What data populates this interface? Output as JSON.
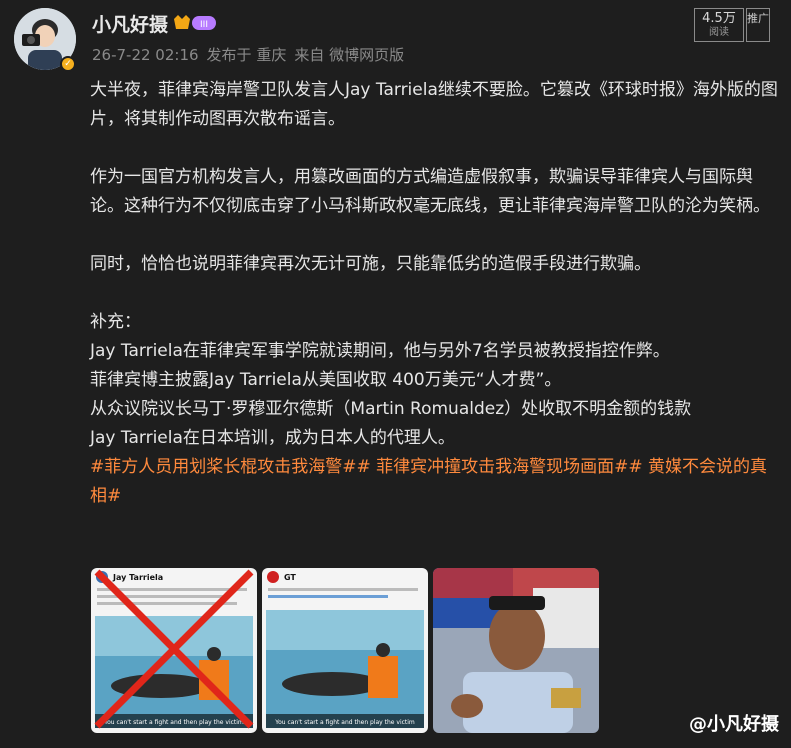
{
  "user": {
    "name": "小凡好摄",
    "vip_level": "III"
  },
  "meta": {
    "time": "26-7-22 02:16",
    "location": "发布于 重庆",
    "source": "来自 微博网页版"
  },
  "stats": {
    "reads": "4.5万",
    "reads_label": "阅读",
    "promote": "推广"
  },
  "post": {
    "p1": "大半夜，菲律宾海岸警卫队发言人Jay Tarriela继续不要脸。它篡改《环球时报》海外版的图片，将其制作动图再次散布谣言。",
    "p2": "作为一国官方机构发言人，用篡改画面的方式编造虚假叙事，欺骗误导菲律宾人与国际舆论。这种行为不仅彻底击穿了小马科斯政权毫无底线，更让菲律宾海岸警卫队的沦为笑柄。",
    "p3": "同时，恰恰也说明菲律宾再次无计可施，只能靠低劣的造假手段进行欺骗。",
    "supp_title": "补充：",
    "s1": "Jay Tarriela在菲律宾军事学院就读期间，他与另外7名学员被教授指控作弊。",
    "s2": "菲律宾博主披露Jay Tarriela从美国收取 400万美元“人才费”。",
    "s3": "从众议院议长马丁·罗穆亚尔德斯（Martin Romualdez）处收取不明金额的钱款",
    "s4": "Jay Tarriela在日本培训，成为日本人的代理人。",
    "hashtags": "#菲方人员用划桨长棍攻击我海警## 菲律宾冲撞攻击我海警现场画面## 黄媒不会说的真相#"
  },
  "images": {
    "img1_name": "Jay Tarriela",
    "img1_caption": "You can't start a fight and then play the victim",
    "img2_name": "GT",
    "img2_caption": "You can't start a fight and then play the victim"
  },
  "watermark": "@小凡好摄"
}
